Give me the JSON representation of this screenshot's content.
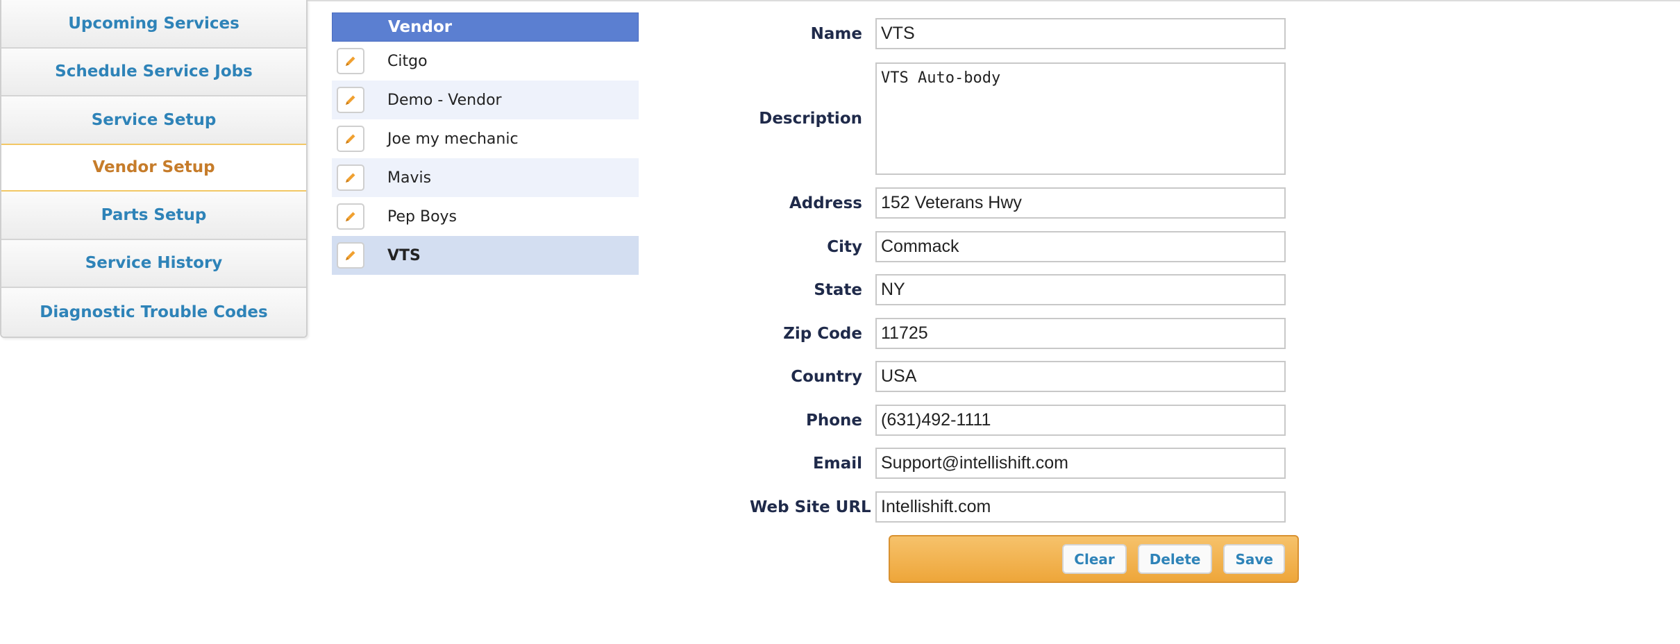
{
  "nav": {
    "items": [
      {
        "label": "Upcoming Services"
      },
      {
        "label": "Schedule Service Jobs"
      },
      {
        "label": "Service Setup"
      },
      {
        "label": "Vendor Setup"
      },
      {
        "label": "Parts Setup"
      },
      {
        "label": "Service History"
      },
      {
        "label": "Diagnostic Trouble Codes"
      }
    ],
    "active": "Vendor Setup"
  },
  "vendors": {
    "header": "Vendor",
    "rows": [
      {
        "name": "Citgo"
      },
      {
        "name": "Demo - Vendor"
      },
      {
        "name": "Joe my mechanic"
      },
      {
        "name": "Mavis"
      },
      {
        "name": "Pep Boys"
      },
      {
        "name": "VTS"
      }
    ],
    "selected": "VTS"
  },
  "form": {
    "name": {
      "label": "Name",
      "value": "VTS"
    },
    "description": {
      "label": "Description",
      "value": "VTS Auto-body"
    },
    "address": {
      "label": "Address",
      "value": "152 Veterans Hwy"
    },
    "city": {
      "label": "City",
      "value": "Commack"
    },
    "state": {
      "label": "State",
      "value": "NY"
    },
    "zip": {
      "label": "Zip Code",
      "value": "11725"
    },
    "country": {
      "label": "Country",
      "value": "USA"
    },
    "phone": {
      "label": "Phone",
      "value": "(631)492-1111"
    },
    "email": {
      "label": "Email",
      "value": "Support@intellishift.com"
    },
    "website": {
      "label": "Web Site URL",
      "value": "Intellishift.com"
    }
  },
  "actions": {
    "clear": "Clear",
    "delete": "Delete",
    "save": "Save"
  },
  "colors": {
    "nav_text": "#2e83b8",
    "nav_active_text": "#c67c2a",
    "vendor_header_bg": "#5b7fd1",
    "action_bar_bg": "#f0ad48",
    "edit_icon": "#f0a030"
  },
  "icons": {
    "row_edit": "pencil-icon"
  }
}
